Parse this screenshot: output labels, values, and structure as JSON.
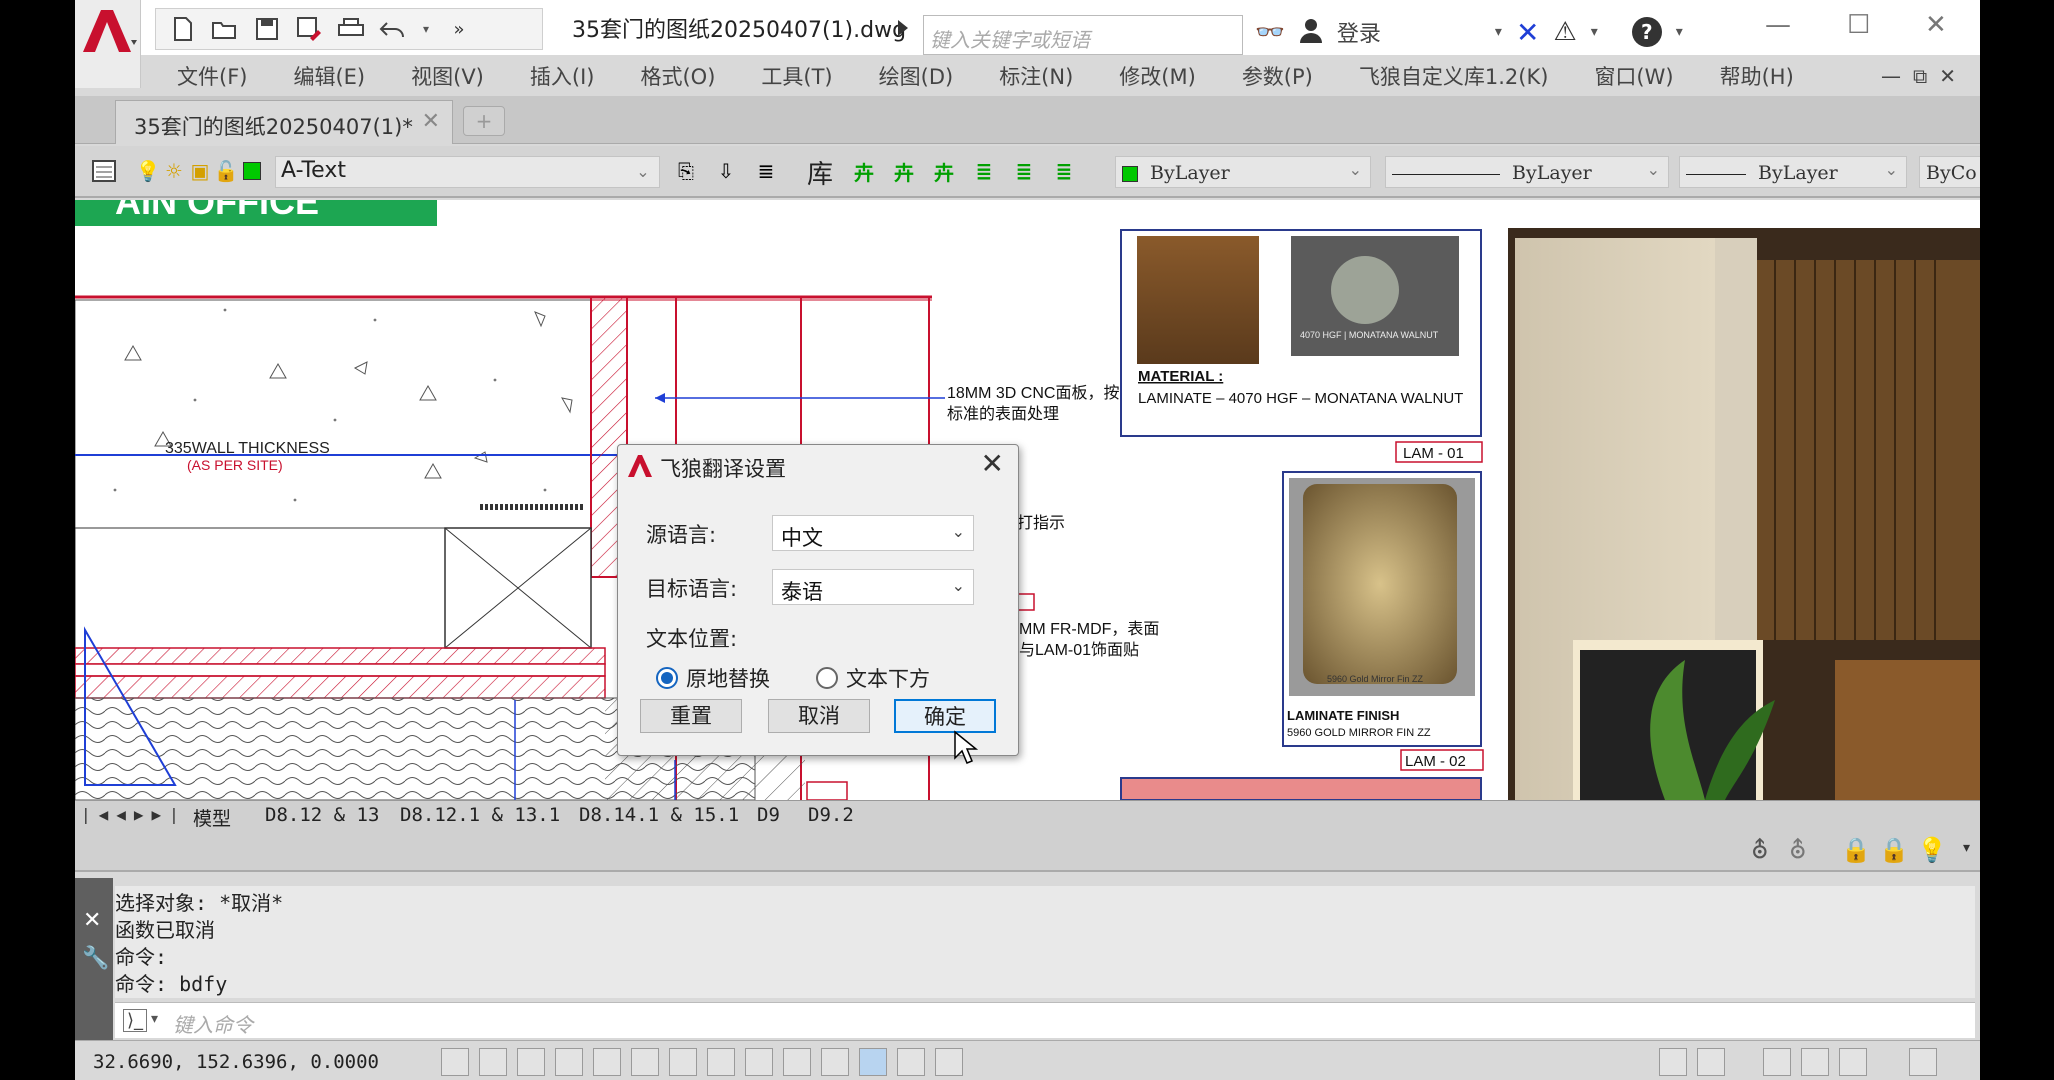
{
  "window": {
    "doc_title": "35套门的图纸20250407(1).dwg",
    "search_placeholder": "键入关键字或短语",
    "login": "登录"
  },
  "menu": [
    "文件(F)",
    "编辑(E)",
    "视图(V)",
    "插入(I)",
    "格式(O)",
    "工具(T)",
    "绘图(D)",
    "标注(N)",
    "修改(M)",
    "参数(P)",
    "飞狼自定义库1.2(K)",
    "窗口(W)",
    "帮助(H)"
  ],
  "doc_tab": {
    "label": "35套门的图纸20250407(1)*"
  },
  "properties": {
    "layer": "A-Text",
    "library_label": "库",
    "color": "ByLayer",
    "linetype": "ByLayer",
    "lineweight": "ByLayer",
    "plotstyle": "ByCo"
  },
  "drawing": {
    "heading_fragment": "AIN OFFICE",
    "wall_label": "335WALL THICKNESS",
    "wall_note": "(AS PER SITE)",
    "note_cnc": "18MM 3D CNC面板，按",
    "note_cnc_2": "标准的表面处理",
    "note_marker": "打指示",
    "note_mdf": "MM FR-MDF，表面",
    "note_mdf_2": "与LAM-01饰面贴",
    "material_heading": "MATERIAL :",
    "material_desc": "LAMINATE – 4070 HGF – MONATANA WALNUT",
    "sample_caption": "4070 HGF | MONATANA WALNUT",
    "lam01": "LAM - 01",
    "finish_heading": "LAMINATE FINISH",
    "finish_desc": "5960 GOLD MIRROR FIN ZZ",
    "finish_caption": "5960 Gold Mirror Fin ZZ",
    "lam02": "LAM - 02"
  },
  "layout_tabs": [
    "模型",
    "D8.12 & 13",
    "D8.12.1 & 13.1",
    "D8.14.1 & 15.1",
    "D9",
    "D9.2"
  ],
  "command": {
    "history": [
      "选择对象: *取消*",
      "函数已取消",
      "命令:",
      "命令: bdfy"
    ],
    "placeholder": "键入命令"
  },
  "status": {
    "coords": "32.6690, 152.6396, 0.0000"
  },
  "dialog": {
    "title": "飞狼翻译设置",
    "source_label": "源语言:",
    "source_value": "中文",
    "target_label": "目标语言:",
    "target_value": "泰语",
    "position_label": "文本位置:",
    "option_replace": "原地替换",
    "option_below": "文本下方",
    "selected_option": "原地替换",
    "btn_reset": "重置",
    "btn_cancel": "取消",
    "btn_ok": "确定"
  },
  "colors": {
    "accent": "#0078d7",
    "heading_band": "#1da652",
    "cad_red": "#c8102e",
    "cad_blue": "#1f3fd6"
  }
}
